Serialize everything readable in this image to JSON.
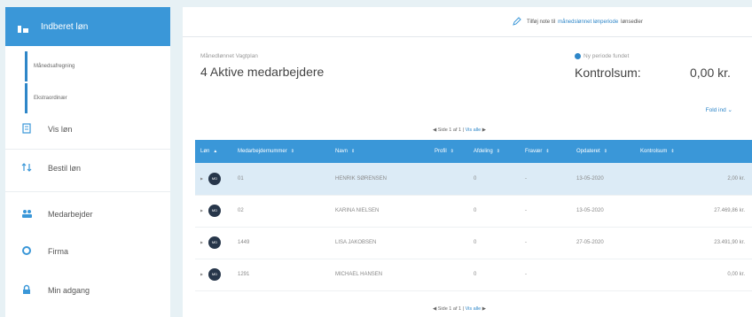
{
  "sidebar": {
    "active_item": {
      "label": "Indberet løn",
      "icon": "report-icon"
    },
    "sub_items": [
      {
        "label": "Månedsafregning"
      },
      {
        "label": "Ekstraordinær"
      }
    ],
    "items": [
      {
        "label": "Vis løn",
        "icon": "document-icon"
      },
      {
        "label": "Bestil løn",
        "icon": "sort-arrows-icon"
      },
      {
        "label": "Medarbejder",
        "icon": "users-icon"
      },
      {
        "label": "Firma",
        "icon": "circle-icon"
      },
      {
        "label": "Min adgang",
        "icon": "lock-icon"
      }
    ]
  },
  "topbar": {
    "note_prefix": "Tilføj note til",
    "note_link": "månedslønnet lønperiode",
    "note_suffix": "lønsedler"
  },
  "summary": {
    "label": "Månedlønnet Vagtplan",
    "title": "4 Aktive medarbejdere",
    "status_label": "Ny periode fundet",
    "control_label": "Kontrolsum:",
    "control_value": "0,00 kr.",
    "fold_label": "Fold ind"
  },
  "pager_top": {
    "text": "Side 1 af 1",
    "link": "Vis alle"
  },
  "pager_bottom": {
    "text": "Side 1 af 1",
    "link": "Vis alle"
  },
  "table": {
    "headers": [
      "Løn",
      "Medarbejdernummer",
      "Navn",
      "Profil",
      "Afdeling",
      "Fravær",
      "Opdateret",
      "Kontrolsum"
    ],
    "rows": [
      {
        "id": "01",
        "name": "HENRIK SØRENSEN",
        "profil": "",
        "afd": "0",
        "fravaer": "-",
        "date": "13-05-2020",
        "sum": "2,00 kr."
      },
      {
        "id": "02",
        "name": "KARINA NIELSEN",
        "profil": "",
        "afd": "0",
        "fravaer": "-",
        "date": "13-05-2020",
        "sum": "27.469,86 kr."
      },
      {
        "id": "1449",
        "name": "LISA JAKOBSEN",
        "profil": "",
        "afd": "0",
        "fravaer": "-",
        "date": "27-05-2020",
        "sum": "23.491,90 kr."
      },
      {
        "id": "1291",
        "name": "MICHAEL HANSEN",
        "profil": "",
        "afd": "0",
        "fravaer": "-",
        "date": "",
        "sum": "0,00 kr."
      }
    ]
  },
  "colors": {
    "accent": "#3a97d8",
    "avatar": "#27364a"
  }
}
